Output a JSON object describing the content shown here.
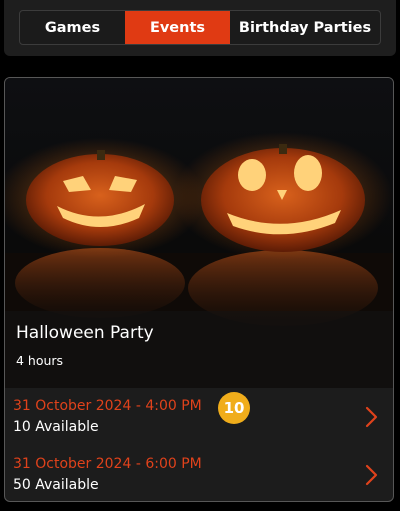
{
  "tabs": [
    {
      "label": "Games",
      "active": false
    },
    {
      "label": "Events",
      "active": true
    },
    {
      "label": "Birthday Parties",
      "active": false
    }
  ],
  "colors": {
    "accent": "#e03a13",
    "time_text": "#e0421b",
    "badge": "#f0ad1b"
  },
  "event": {
    "title": "Halloween Party",
    "duration": "4 hours",
    "slots": [
      {
        "datetime": "31 October 2024 - 4:00 PM",
        "availability": "10 Available",
        "badge": "10",
        "icon": "chevron-right-icon"
      },
      {
        "datetime": "31 October 2024 - 6:00 PM",
        "availability": "50 Available",
        "icon": "chevron-right-icon"
      }
    ]
  }
}
